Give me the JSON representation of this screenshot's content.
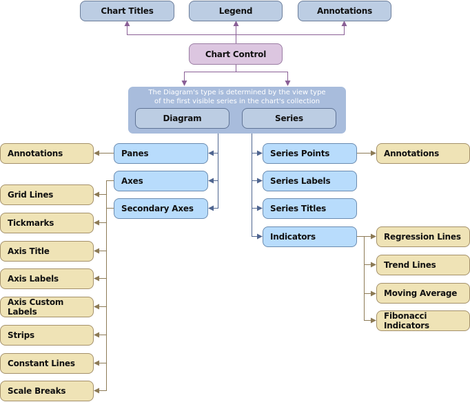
{
  "top_row": {
    "chart_titles": "Chart Titles",
    "legend": "Legend",
    "annotations": "Annotations"
  },
  "chart_control": "Chart Control",
  "diagram_note": {
    "line1": "The Diagram's type is determined by the view type",
    "line2": "of the first visible series in the chart's collection"
  },
  "diagram": {
    "label": "Diagram",
    "children": {
      "panes": "Panes",
      "axes": "Axes",
      "secondary_axes": "Secondary Axes"
    },
    "panes_children": [
      "Annotations"
    ],
    "axes_children": [
      "Grid Lines",
      "Tickmarks",
      "Axis Title",
      "Axis Labels",
      "Axis Custom Labels",
      "Strips",
      "Constant Lines",
      "Scale Breaks"
    ]
  },
  "series": {
    "label": "Series",
    "children": {
      "series_points": "Series Points",
      "series_labels": "Series Labels",
      "series_titles": "Series Titles",
      "indicators": "Indicators"
    },
    "series_points_children": [
      "Annotations"
    ],
    "indicators_children": [
      "Regression Lines",
      "Trend Lines",
      "Moving Average",
      "Fibonacci Indicators"
    ]
  },
  "colors": {
    "purple_line": "#8a5f96",
    "blue_line": "#4f6590",
    "tan_line": "#8c7a55"
  }
}
